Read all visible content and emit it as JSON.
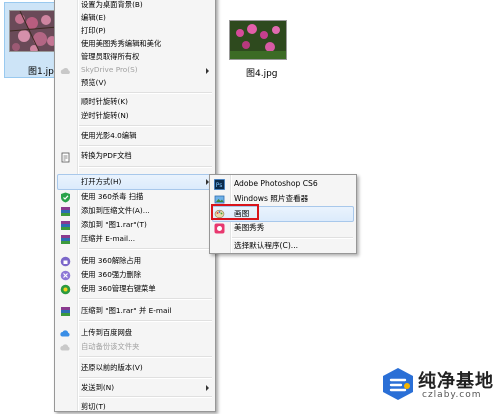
{
  "files": [
    {
      "name": "图1.jpg",
      "selected": true
    },
    {
      "name": "图4.jpg",
      "selected": false
    }
  ],
  "context_menu": {
    "items": [
      {
        "label": "设置为桌面背景(B)",
        "icon": "none",
        "disabled": false
      },
      {
        "label": "编辑(E)",
        "icon": "none",
        "disabled": false
      },
      {
        "label": "打印(P)",
        "icon": "none",
        "disabled": false
      },
      {
        "label": "使用美图秀秀编辑和美化",
        "icon": "none",
        "disabled": false
      },
      {
        "label": "管理员取得所有权",
        "icon": "none",
        "disabled": false
      },
      {
        "label": "SkyDrive Pro(S)",
        "icon": "skydrive-icon",
        "disabled": true,
        "submenu": true
      },
      {
        "label": "预览(V)",
        "icon": "none",
        "disabled": false
      },
      {
        "label": "顺时针旋转(K)",
        "icon": "none",
        "disabled": false
      },
      {
        "label": "逆时针旋转(N)",
        "icon": "none",
        "disabled": false
      },
      {
        "label": "使用光影4.0编辑",
        "icon": "none",
        "disabled": false
      },
      {
        "label": "转换为PDF文档",
        "icon": "pdf-icon",
        "disabled": false
      },
      {
        "label": "打开方式(H)",
        "icon": "none",
        "disabled": false,
        "submenu": true,
        "highlighted": true
      },
      {
        "label": "使用 360杀毒 扫描",
        "icon": "shield-icon",
        "disabled": false
      },
      {
        "label": "添加到压缩文件(A)...",
        "icon": "archive-icon",
        "disabled": false
      },
      {
        "label": "添加到 \"图1.rar\"(T)",
        "icon": "archive-icon",
        "disabled": false
      },
      {
        "label": "压缩并 E-mail...",
        "icon": "archive-icon",
        "disabled": false
      },
      {
        "label": "使用 360解除占用",
        "icon": "unlock-icon",
        "disabled": false
      },
      {
        "label": "使用 360强力删除",
        "icon": "shred-icon",
        "disabled": false
      },
      {
        "label": "使用 360管理右键菜单",
        "icon": "menu-manager-icon",
        "disabled": false
      },
      {
        "label": "压缩到 \"图1.rar\" 并 E-mail",
        "icon": "archive-icon",
        "disabled": false
      },
      {
        "label": "上传到百度网盘",
        "icon": "cloud-icon",
        "disabled": false
      },
      {
        "label": "自动备份该文件夹",
        "icon": "cloud-icon",
        "disabled": true
      },
      {
        "label": "还原以前的版本(V)",
        "icon": "none",
        "disabled": false
      },
      {
        "label": "发送到(N)",
        "icon": "none",
        "disabled": false,
        "submenu": true
      },
      {
        "label": "剪切(T)",
        "icon": "none",
        "disabled": false
      }
    ]
  },
  "open_with_submenu": {
    "items": [
      {
        "label": "Adobe Photoshop CS6",
        "icon": "photoshop-icon"
      },
      {
        "label": "Windows 照片查看器",
        "icon": "photo-viewer-icon"
      },
      {
        "label": "画图",
        "icon": "paint-icon",
        "highlighted": true
      },
      {
        "label": "美图秀秀",
        "icon": "meitu-icon"
      },
      {
        "label": "选择默认程序(C)...",
        "icon": "none"
      }
    ]
  },
  "watermark": {
    "title": "纯净基地",
    "url": "czlaby.com"
  },
  "colors": {
    "highlight_border": "#a8c8eb",
    "red_box": "#d8141b",
    "selection": "#cde4f7"
  }
}
